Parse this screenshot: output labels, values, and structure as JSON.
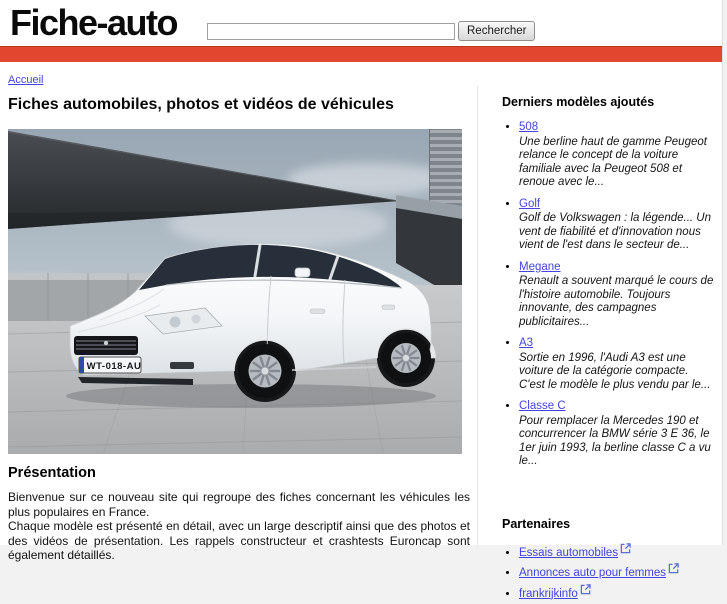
{
  "header": {
    "logo": "Fiche-auto",
    "search": {
      "value": "",
      "placeholder": "",
      "button_label": "Rechercher"
    }
  },
  "breadcrumb": {
    "home": "Accueil"
  },
  "main": {
    "title": "Fiches automobiles, photos et vidéos de véhicules",
    "image": {
      "license_plate": "WT-018-AU"
    },
    "presentation": {
      "title": "Présentation",
      "paragraphs": [
        "Bienvenue sur ce nouveau site qui regroupe des fiches concernant les véhicules les plus populaires en France.",
        "Chaque modèle est présenté en détail, avec un large descriptif ainsi que des photos et des vidéos de présentation. Les rappels constructeur et crashtests Euroncap sont également détaillés."
      ]
    }
  },
  "sidebar": {
    "latest_models": {
      "title": "Derniers modèles ajoutés",
      "items": [
        {
          "label": "508",
          "description": "Une berline haut de gamme Peugeot relance le concept de la voiture familiale avec la Peugeot 508 et renoue avec le..."
        },
        {
          "label": "Golf",
          "description": "Golf de Volkswagen : la légende... Un vent de fiabilité et d'innovation nous vient de l'est dans le secteur de..."
        },
        {
          "label": "Megane",
          "description": "Renault a souvent marqué le cours de l'histoire automobile. Toujours innovante, des campagnes publicitaires..."
        },
        {
          "label": "A3",
          "description": "Sortie en 1996, l'Audi A3 est une voiture de la catégorie compacte. C'est le modèle le plus vendu par le..."
        },
        {
          "label": "Classe C",
          "description": "Pour remplacer la Mercedes 190 et concurrencer la BMW série 3 E 36, le 1er juin 1993, la berline classe C a vu le..."
        }
      ]
    },
    "partners": {
      "title": "Partenaires",
      "items": [
        {
          "label": "Essais automobiles"
        },
        {
          "label": "Annonces auto pour femmes"
        },
        {
          "label": "frankrijkinfo"
        }
      ]
    }
  },
  "colors": {
    "accent_red": "#e2462e",
    "link_blue": "#4444dd"
  }
}
